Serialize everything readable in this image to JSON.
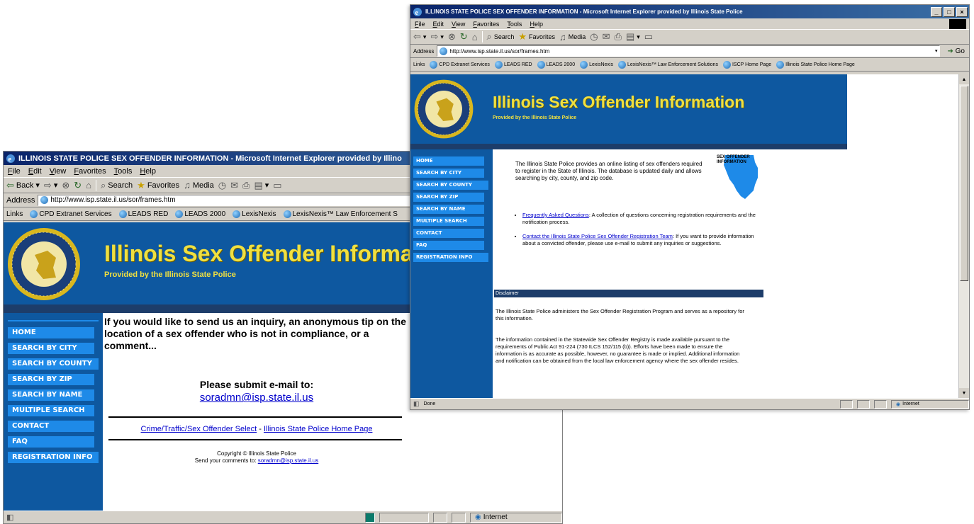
{
  "back_window": {
    "title": "ILLINOIS STATE POLICE SEX OFFENDER INFORMATION - Microsoft Internet Explorer provided by Illino",
    "menu": [
      "File",
      "Edit",
      "View",
      "Favorites",
      "Tools",
      "Help"
    ],
    "toolbar": {
      "back": "Back",
      "search": "Search",
      "favorites": "Favorites",
      "media": "Media"
    },
    "address_label": "Address",
    "address_url": "http://www.isp.state.il.us/sor/frames.htm",
    "links_label": "Links",
    "links": [
      "CPD Extranet Services",
      "LEADS RED",
      "LEADS 2000",
      "LexisNexis",
      "LexisNexis™ Law Enforcement S"
    ],
    "banner_title": "Illinois Sex Offender Informatio",
    "banner_sub": "Provided by the Illinois State Police",
    "nav": [
      "HOME",
      "SEARCH BY CITY",
      "SEARCH BY COUNTY",
      "SEARCH BY ZIP",
      "SEARCH BY NAME",
      "MULTIPLE SEARCH",
      "CONTACT",
      "FAQ",
      "REGISTRATION INFO"
    ],
    "intro": "If you would like to send us an inquiry, an anonymous tip on the location of a sex offender who is not in compliance, or a comment...",
    "submit_label": "Please submit e-mail to:",
    "email": "soradmn@isp.state.il.us",
    "footer_link_1": "Crime/Traffic/Sex Offender Select",
    "footer_sep": " - ",
    "footer_link_2": "Illinois State Police Home Page",
    "copyright": "Copyright © Illinois State Police",
    "comments_prefix": "Send your comments to: ",
    "comments_email": "soradmn@isp.state.il.us",
    "status_zone": "Internet"
  },
  "front_window": {
    "title": "ILLINOIS STATE POLICE SEX OFFENDER INFORMATION - Microsoft Internet Explorer provided by Illinois State Police",
    "menu": [
      "File",
      "Edit",
      "View",
      "Favorites",
      "Tools",
      "Help"
    ],
    "toolbar": {
      "search": "Search",
      "favorites": "Favorites",
      "media": "Media"
    },
    "address_label": "Address",
    "address_url": "http://www.isp.state.il.us/sor/frames.htm",
    "go_label": "Go",
    "links_label": "Links",
    "links": [
      "CPD Extranet Services",
      "LEADS RED",
      "LEADS 2000",
      "LexisNexis",
      "LexisNexis™ Law Enforcement Solutions",
      "ISCP Home Page",
      "Illinois State Police Home Page"
    ],
    "banner_title": "Illinois Sex Offender Information",
    "banner_sub": "Provided by the Illinois State Police",
    "nav": [
      "HOME",
      "SEARCH BY CITY",
      "SEARCH BY COUNTY",
      "SEARCH BY ZIP",
      "SEARCH BY NAME",
      "MULTIPLE SEARCH",
      "CONTACT",
      "FAQ",
      "REGISTRATION INFO"
    ],
    "intro": "The Illinois State Police provides an online listing of sex offenders required to register in the State of Illinois. The database is updated daily and allows searching by city, county, and zip code.",
    "map_label": "SEX OFFENDER INFORMATION",
    "bullet1_link": "Frequently Asked Questions",
    "bullet1_text": ": A collection of questions concerning registration requirements and the notification process.",
    "bullet2_link": "Contact the Illinois State Police Sex Offender Registration Team",
    "bullet2_text": ": If you want to provide information about a convicted offender, please use e-mail to submit any inquiries or suggestions.",
    "disclaimer_heading": "Disclaimer",
    "disclaimer_p1": "The Illinois State Police administers the Sex Offender Registration Program and serves as a repository for this information.",
    "disclaimer_p2": "The information contained in the Statewide Sex Offender Registry is made available pursuant to the requirements of Public Act 91-224 (730 ILCS 152/115 (b)). Efforts have been made to ensure the information is as accurate as possible, however, no guarantee is made or implied. Additional information and notification can be obtained from the local law enforcement agency where the sex offender resides.",
    "status_text": "Done",
    "status_zone": "Internet"
  },
  "colors": {
    "banner_blue": "#0e58a0",
    "nav_button": "#1e8ae8",
    "banner_text": "#f0e040",
    "title_bar": "#0a246a",
    "disclaimer_bar": "#1d3d6a"
  },
  "icons": [
    "ie-logo-icon",
    "back-arrow-icon",
    "forward-arrow-icon",
    "stop-icon",
    "refresh-icon",
    "home-icon",
    "search-icon",
    "favorites-icon",
    "media-icon",
    "history-icon",
    "mail-icon",
    "print-icon",
    "edit-icon",
    "messenger-icon",
    "page-icon",
    "link-icon",
    "globe-icon",
    "state-police-seal-icon",
    "illinois-map-icon"
  ]
}
